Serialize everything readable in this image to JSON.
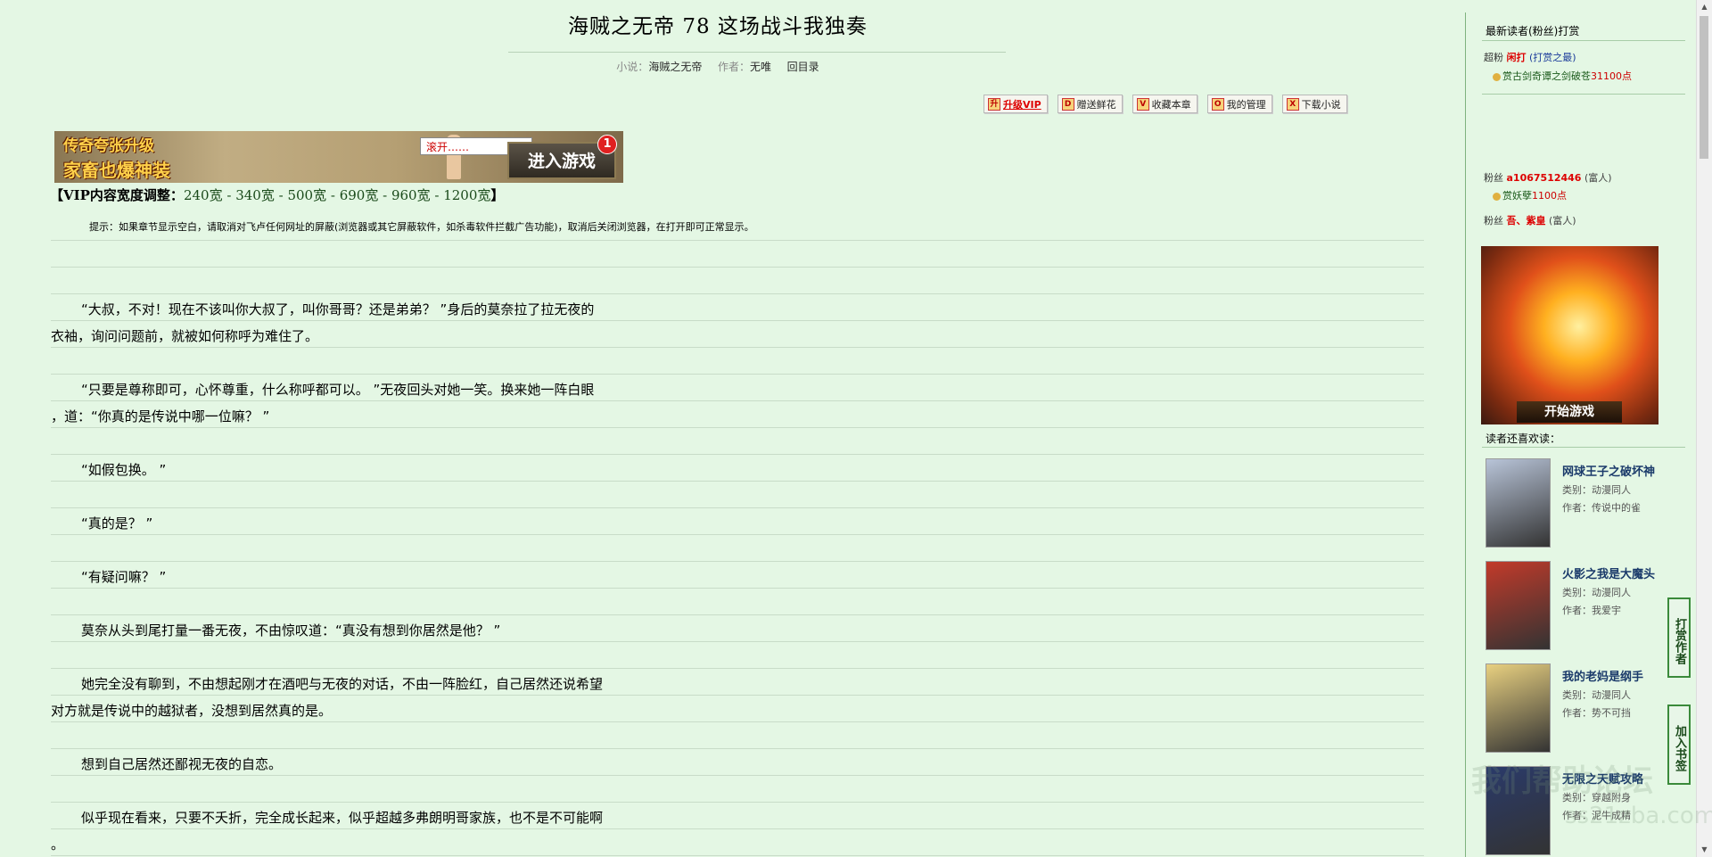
{
  "header": {
    "title": "海贼之无帝  78  这场战斗我独奏",
    "meta": {
      "novel_label": "小说：",
      "novel_value": "海贼之无帝",
      "author_label": "作者：",
      "author_value": "无唯",
      "toc_link": "回目录"
    }
  },
  "toolbar": [
    {
      "icon": "升",
      "label": "升级VIP",
      "name": "upgrade-vip-button"
    },
    {
      "icon": "D",
      "label": "赠送鲜花",
      "name": "send-flowers-button"
    },
    {
      "icon": "V",
      "label": "收藏本章",
      "name": "bookmark-chapter-button"
    },
    {
      "icon": "O",
      "label": "我的管理",
      "name": "my-management-button"
    },
    {
      "icon": "X",
      "label": "下载小说",
      "name": "download-novel-button"
    }
  ],
  "banner": {
    "line1": "传奇夸张升级",
    "line2": "家畜也爆神装",
    "bubble": "滚开……",
    "cta": "进入游戏",
    "badge": "1"
  },
  "vip_width": {
    "label": "【VIP内容宽度调整：",
    "options": [
      "240宽",
      "340宽",
      "500宽",
      "690宽",
      "960宽",
      "1200宽"
    ],
    "separator": " - ",
    "close": "】"
  },
  "tip": "提示：如果章节显示空白，请取消对飞卢任何网址的屏蔽(浏览器或其它屏蔽软件，如杀毒软件拦截广告功能)，取消后关闭浏览器，在打开即可正常显示。",
  "paragraphs": [
    {
      "indent": true,
      "text": "“大叔，不对！现在不该叫你大叔了，叫你哥哥？还是弟弟？ ”身后的莫奈拉了拉无夜的"
    },
    {
      "indent": false,
      "text": "衣袖，询问问题前，就被如何称呼为难住了。"
    },
    {
      "indent": true,
      "text": "“只要是尊称即可，心怀尊重，什么称呼都可以。 ”无夜回头对她一笑。换来她一阵白眼"
    },
    {
      "indent": false,
      "text": "，道：“你真的是传说中哪一位嘛？ ”"
    },
    {
      "indent": true,
      "text": "“如假包换。 ”"
    },
    {
      "indent": true,
      "text": "“真的是？ ”"
    },
    {
      "indent": true,
      "text": "“有疑问嘛？ ”"
    },
    {
      "indent": true,
      "text": "莫奈从头到尾打量一番无夜，不由惊叹道：“真没有想到你居然是他？ ”"
    },
    {
      "indent": true,
      "text": "她完全没有聊到，不由想起刚才在酒吧与无夜的对话，不由一阵脸红，自己居然还说希望"
    },
    {
      "indent": false,
      "text": "对方就是传说中的越狱者，没想到居然真的是。"
    },
    {
      "indent": true,
      "text": "想到自己居然还鄙视无夜的自恋。"
    },
    {
      "indent": true,
      "text": "似乎现在看来，只要不夭折，完全成长起来，似乎超越多弗朗明哥家族，也不是不可能啊"
    },
    {
      "indent": false,
      "text": "。"
    }
  ],
  "sidebar": {
    "rewards_heading": "最新读者(粉丝)打赏",
    "fans": [
      {
        "level": "超粉",
        "name": "闲打",
        "tag": "(打赏之最)",
        "reward_prefix": "赏",
        "reward_item": "古剑奇谭之剑破苍",
        "reward_points": "31100点"
      },
      {
        "level": "粉丝",
        "name": "a1067512446",
        "tag": "(富人)",
        "reward_prefix": "赏",
        "reward_item": "妖孽",
        "reward_points": "1100点"
      },
      {
        "level": "粉丝",
        "name": "吾、紫皇",
        "tag": "(富人)"
      }
    ],
    "ad_cta": "开始游戏",
    "also_like_heading": "读者还喜欢读：",
    "books": [
      {
        "title": "网球王子之破坏神",
        "category": "类别：动漫同人",
        "author": "作者：传说中的雀",
        "cover": "#b8c4d8"
      },
      {
        "title": "火影之我是大魔头",
        "category": "类别：动漫同人",
        "author": "作者：我爱宇",
        "cover": "#c23a2a"
      },
      {
        "title": "我的老妈是纲手",
        "category": "类别：动漫同人",
        "author": "作者：势不可挡",
        "cover": "#e8d080"
      },
      {
        "title": "无限之天赋攻略",
        "category": "类别：穿越附身",
        "author": "作者：泥牛成精",
        "cover": "#2a3a6a"
      }
    ],
    "float_reward": "打赏作者",
    "float_bookmark": "加入书签",
    "watermark": "我们帮助论坛",
    "watermark2": "ss21zba.com"
  }
}
